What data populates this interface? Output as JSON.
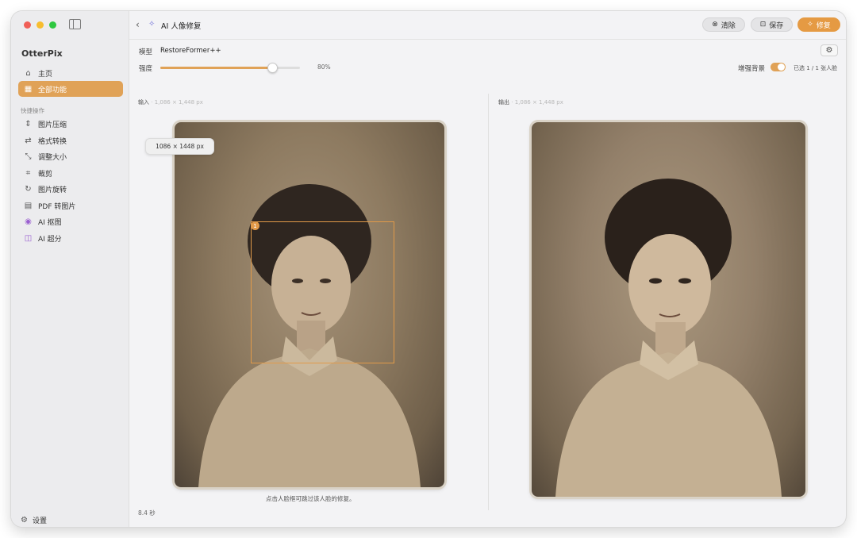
{
  "app": {
    "name": "OtterPix"
  },
  "sidebar": {
    "primary": [
      {
        "label": "主页",
        "icon": "home-icon"
      },
      {
        "label": "全部功能",
        "icon": "grid-icon",
        "active": true
      }
    ],
    "section_label": "快捷操作",
    "quick": [
      {
        "label": "图片压缩",
        "icon": "compress-icon"
      },
      {
        "label": "格式转换",
        "icon": "convert-icon"
      },
      {
        "label": "调整大小",
        "icon": "resize-icon"
      },
      {
        "label": "裁剪",
        "icon": "crop-icon"
      },
      {
        "label": "图片旋转",
        "icon": "rotate-icon"
      },
      {
        "label": "PDF 转图片",
        "icon": "pdf-icon"
      },
      {
        "label": "AI 抠图",
        "icon": "person-cutout-icon"
      },
      {
        "label": "AI 超分",
        "icon": "upscale-icon"
      }
    ],
    "settings_label": "设置"
  },
  "header": {
    "title": "AI 人像修复",
    "clear_label": "清除",
    "save_label": "保存",
    "repair_label": "修复"
  },
  "controls": {
    "model_label": "模型",
    "model_value": "RestoreFormer++",
    "strength_label": "强度",
    "strength_value": "80%",
    "strength_fraction": 0.8,
    "enhance_bg_label": "增强背景",
    "enhance_bg_on": true,
    "face_count": "已选 1 / 1 张人脸"
  },
  "input_panel": {
    "label": "输入",
    "dims": "1,086 × 1,448 px",
    "tooltip": "1086 × 1448 px",
    "face_index": "1",
    "hint": "点击人脸框可跳过该人脸的修复。"
  },
  "output_panel": {
    "label": "输出",
    "dims": "1,086 × 1,448 px"
  },
  "status": {
    "elapsed": "8.4 秒"
  },
  "colors": {
    "accent": "#e0a257",
    "repair_button": "#e59a43",
    "sepia": "#8d7a60"
  }
}
